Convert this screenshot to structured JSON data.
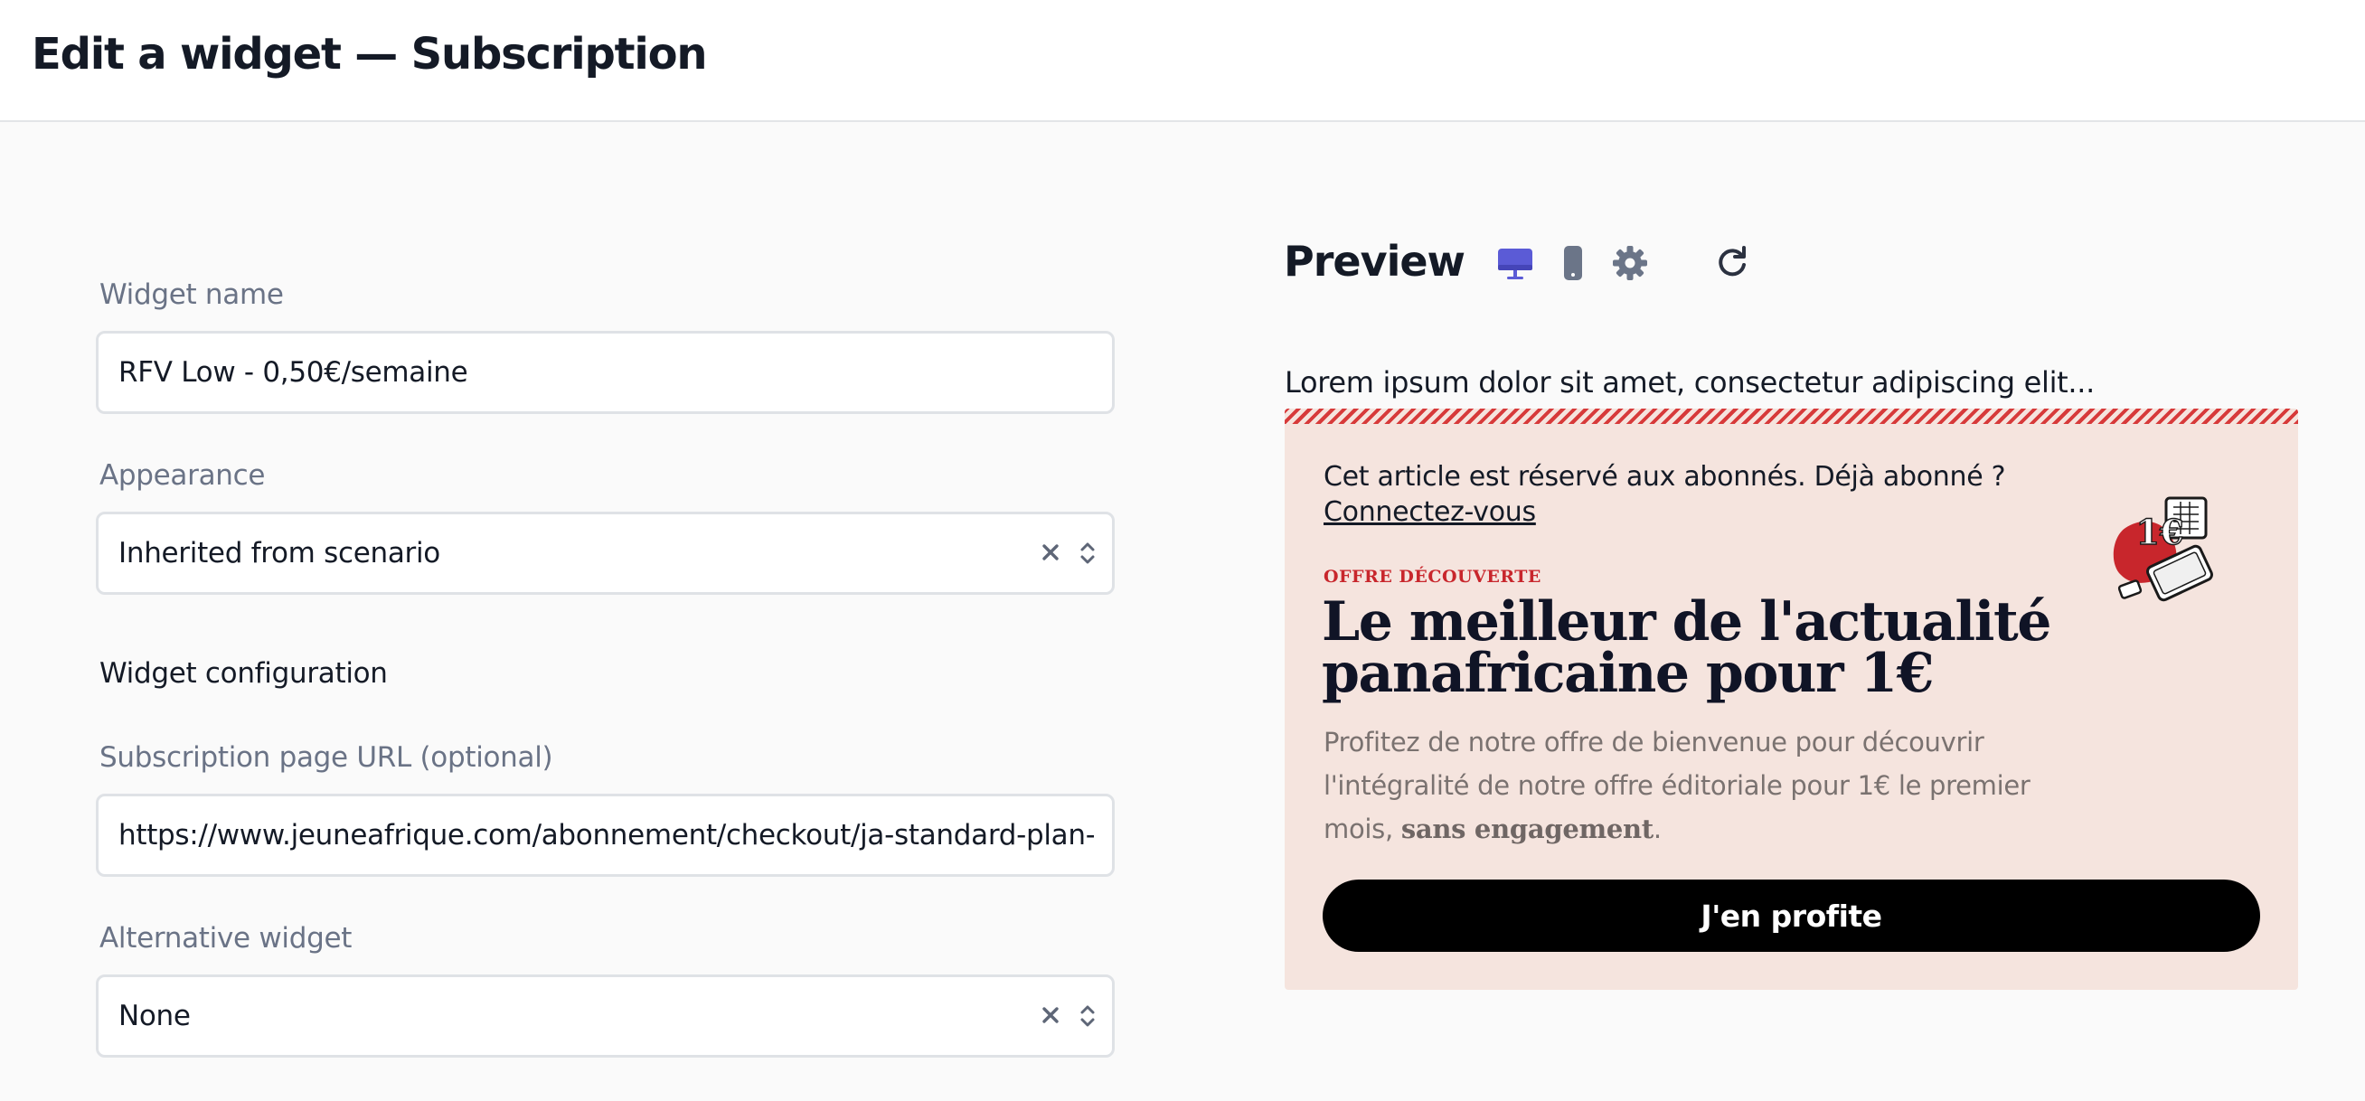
{
  "header": {
    "title": "Edit a widget — Subscription"
  },
  "form": {
    "widget_name": {
      "label": "Widget name",
      "value": "RFV Low - 0,50€/semaine"
    },
    "appearance": {
      "label": "Appearance",
      "value": "Inherited from scenario"
    },
    "section_title": "Widget configuration",
    "subscription_url": {
      "label": "Subscription page URL (optional)",
      "value": "https://www.jeuneafrique.com/abonnement/checkout/ja-standard-plan-m"
    },
    "alternative_widget": {
      "label": "Alternative widget",
      "value": "None"
    }
  },
  "preview": {
    "title": "Preview",
    "toolbar": {
      "active_device": "desktop",
      "icons": [
        "desktop-icon",
        "mobile-icon",
        "settings-icon",
        "refresh-icon"
      ]
    },
    "article_text": "Lorem ipsum dolor sit amet, consectetur adipiscing elit...",
    "paywall": {
      "intro": "Cet article est réservé aux abonnés. Déjà abonné ?",
      "login_link": "Connectez-vous",
      "kicker": "OFFRE DÉCOUVERTE",
      "headline": "Le meilleur de l'actualité panafricaine pour 1€",
      "description": "Profitez de notre offre de bienvenue pour découvrir l'intégralité de notre offre éditoriale pour 1€ le premier mois,",
      "description_bold": "sans engagement",
      "description_end": ".",
      "button_label": "J'en profite",
      "illustration_text": "1€"
    }
  },
  "colors": {
    "accent": "#5b5bd6",
    "label_gray": "#6a7386",
    "paywall_bg": "#f5e4de",
    "paywall_red": "#d73a3a",
    "button_bg": "#000000"
  }
}
